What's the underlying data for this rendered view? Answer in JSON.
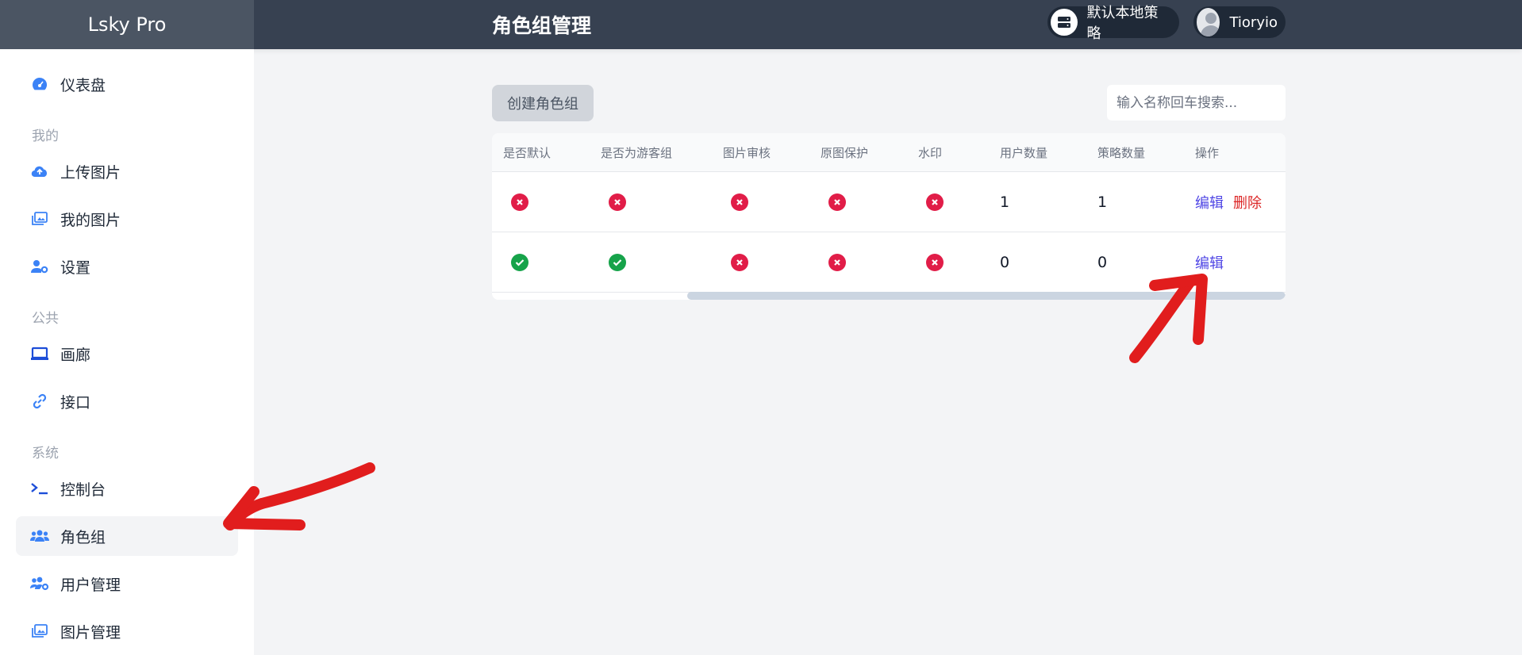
{
  "brand": "Lsky Pro",
  "page_title": "角色组管理",
  "header": {
    "strategy_label": "默认本地策略",
    "user_name": "Tioryio"
  },
  "sidebar": {
    "dashboard": "仪表盘",
    "section_mine": "我的",
    "upload": "上传图片",
    "my_images": "我的图片",
    "settings": "设置",
    "section_public": "公共",
    "gallery": "画廊",
    "api": "接口",
    "section_system": "系统",
    "console": "控制台",
    "groups": "角色组",
    "users": "用户管理",
    "images": "图片管理"
  },
  "toolbar": {
    "create_label": "创建角色组",
    "search_placeholder": "输入名称回车搜索..."
  },
  "table": {
    "headers": [
      "是否默认",
      "是否为游客组",
      "图片审核",
      "原图保护",
      "水印",
      "用户数量",
      "策略数量",
      "操作"
    ],
    "rows": [
      {
        "is_default": false,
        "is_guest": false,
        "audit": false,
        "protect": false,
        "watermark": false,
        "user_count": "1",
        "strategy_count": "1",
        "edit": "编辑",
        "delete": "删除"
      },
      {
        "is_default": true,
        "is_guest": true,
        "audit": false,
        "protect": false,
        "watermark": false,
        "user_count": "0",
        "strategy_count": "0",
        "edit": "编辑"
      }
    ]
  },
  "colors": {
    "topbar": "#374151",
    "brand_bg": "#4b5563",
    "accent": "#3b82f6",
    "no": "#e11d48",
    "yes": "#16a34a",
    "edit_link": "#4f46e5",
    "delete_link": "#dc2626",
    "annotation": "#e11d1d"
  }
}
